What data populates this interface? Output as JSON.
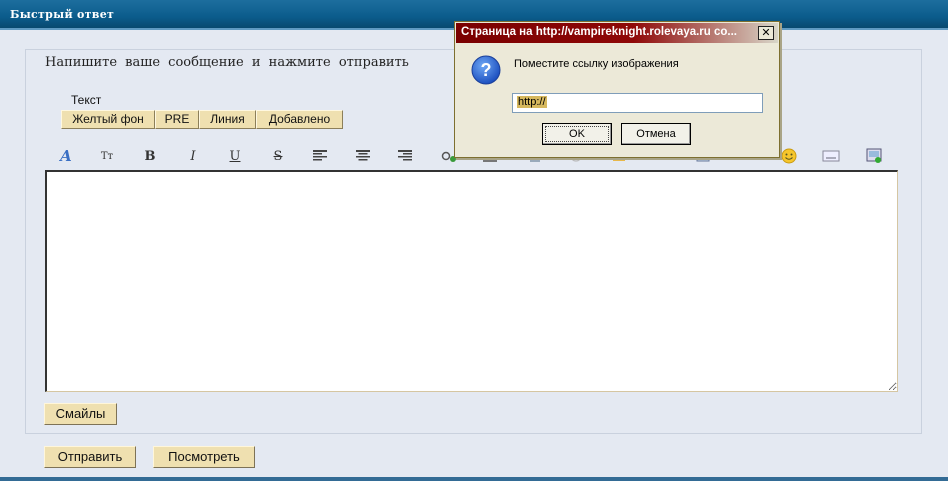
{
  "header": {
    "title": "Быстрый ответ"
  },
  "form": {
    "prompt": "Напишите ваше сообщение и нажмите отправить",
    "text_label": "Текст",
    "format_buttons": [
      "Желтый фон",
      "PRE",
      "Линия",
      "Добавлено"
    ],
    "smileys_button": "Смайлы",
    "submit_button": "Отправить",
    "preview_button": "Посмотреть",
    "editor_value": ""
  },
  "toolbar": {
    "icons": [
      "font-color-icon",
      "font-size-icon",
      "bold-icon",
      "italic-icon",
      "underline-icon",
      "strikethrough-icon",
      "align-left-icon",
      "align-center-icon",
      "align-right-icon",
      "link-icon",
      "image-icon",
      "quote-icon",
      "code-icon",
      "spoiler-icon",
      "hide-icon",
      "table-icon",
      "color-icon",
      "smiley-icon",
      "keyboard-icon",
      "media-icon"
    ],
    "glyphs": {
      "font_color": "A",
      "font_size": "Tт",
      "bold": "B",
      "italic": "I",
      "underline": "U",
      "strike": "S"
    }
  },
  "dialog": {
    "title": "Страница на http://vampireknight.rolevaya.ru со...",
    "close_glyph": "✕",
    "message": "Поместите ссылку изображения",
    "input_value": "http://",
    "ok_button": "OK",
    "cancel_button": "Отмена",
    "accent_color": "#8a0000"
  }
}
